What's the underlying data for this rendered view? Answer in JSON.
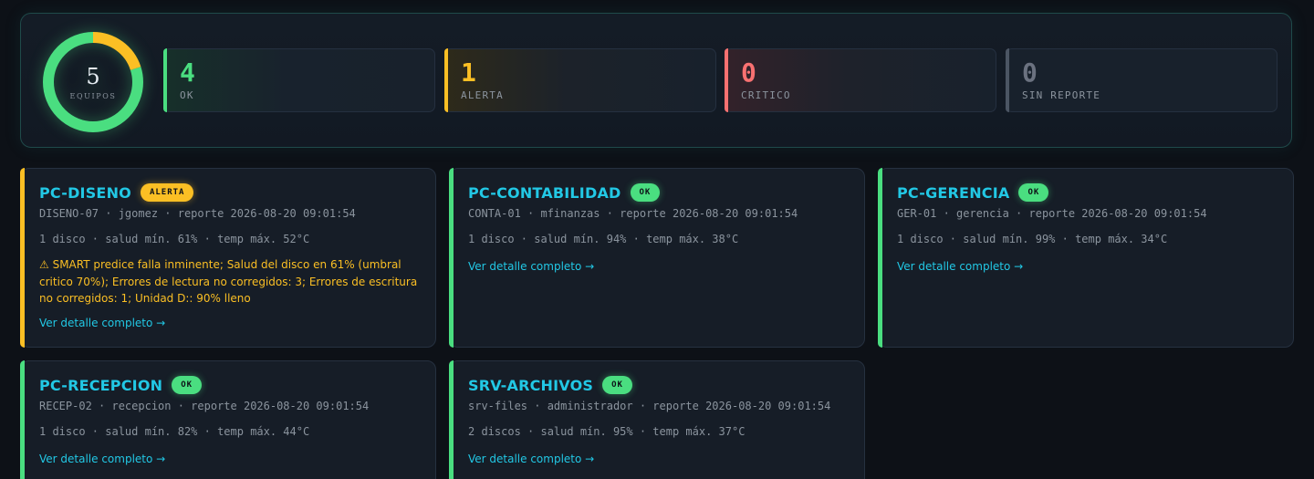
{
  "summary": {
    "total": "5",
    "total_label": "EQUIPOS",
    "donut": {
      "ok": 4,
      "alert": 1,
      "critical": 0,
      "no_report": 0,
      "ok_color": "#4ade80",
      "alert_color": "#fbbf24"
    },
    "stats": [
      {
        "value": "4",
        "label": "OK",
        "color": "#4ade80"
      },
      {
        "value": "1",
        "label": "ALERTA",
        "color": "#fbbf24"
      },
      {
        "value": "0",
        "label": "CRITICO",
        "color": "#f87171"
      },
      {
        "value": "0",
        "label": "SIN REPORTE",
        "color": "#6b7280"
      }
    ]
  },
  "cards": [
    {
      "title": "PC-DISENO",
      "badge": "ALERTA",
      "meta": "DISENO-07 · jgomez · reporte 2026-08-20 09:01:54",
      "stats": "1 disco · salud mín. 61% · temp máx. 52°C",
      "warning": "⚠ SMART predice falla inminente; Salud del disco en 61% (umbral critico 70%); Errores de lectura no corregidos: 3; Errores de escritura no corregidos: 1; Unidad D:: 90% lleno",
      "link": "Ver detalle completo →"
    },
    {
      "title": "PC-CONTABILIDAD",
      "badge": "OK",
      "meta": "CONTA-01 · mfinanzas · reporte 2026-08-20 09:01:54",
      "stats": "1 disco · salud mín. 94% · temp máx. 38°C",
      "link": "Ver detalle completo →"
    },
    {
      "title": "PC-GERENCIA",
      "badge": "OK",
      "meta": "GER-01 · gerencia · reporte 2026-08-20 09:01:54",
      "stats": "1 disco · salud mín. 99% · temp máx. 34°C",
      "link": "Ver detalle completo →"
    },
    {
      "title": "PC-RECEPCION",
      "badge": "OK",
      "meta": "RECEP-02 · recepcion · reporte 2026-08-20 09:01:54",
      "stats": "1 disco · salud mín. 82% · temp máx. 44°C",
      "link": "Ver detalle completo →"
    },
    {
      "title": "SRV-ARCHIVOS",
      "badge": "OK",
      "meta": "srv-files · administrador · reporte 2026-08-20 09:01:54",
      "stats": "2 discos · salud mín. 95% · temp máx. 37°C",
      "link": "Ver detalle completo →"
    }
  ]
}
